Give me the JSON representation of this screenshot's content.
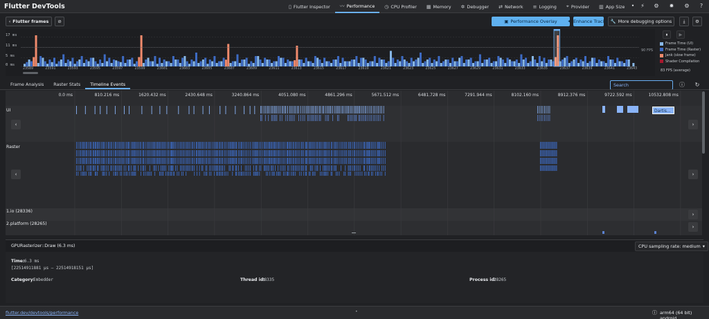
{
  "app": {
    "title": "Flutter DevTools"
  },
  "nav": {
    "tabs": [
      {
        "label": "Flutter Inspector",
        "icon": "phone-icon",
        "glyph": "▯"
      },
      {
        "label": "Performance",
        "icon": "pulse-icon",
        "glyph": "〰"
      },
      {
        "label": "CPU Profiler",
        "icon": "timer-icon",
        "glyph": "◷"
      },
      {
        "label": "Memory",
        "icon": "memory-icon",
        "glyph": "▦"
      },
      {
        "label": "Debugger",
        "icon": "bug-icon",
        "glyph": "✲"
      },
      {
        "label": "Network",
        "icon": "network-icon",
        "glyph": "⇄"
      },
      {
        "label": "Logging",
        "icon": "list-icon",
        "glyph": "≡"
      },
      {
        "label": "Provider",
        "icon": "provider-icon",
        "glyph": "⌖"
      },
      {
        "label": "App Size",
        "icon": "insert-chart-icon",
        "glyph": "▥"
      }
    ],
    "active_tab": "Performance"
  },
  "toolbar": {
    "flutter_frames": "Flutter frames",
    "performance_overlay": "Performance Overlay",
    "enhance_tracing": "Enhance Tracing",
    "more_debugging": "More debugging options"
  },
  "frames_chart": {
    "y_labels": [
      "17 ms",
      "11 ms",
      "5 ms",
      "0 ms"
    ],
    "x_labels": [
      "23589",
      "23591",
      "23593",
      "23595",
      "23597",
      "23599",
      "23601",
      "23603",
      "23605",
      "23607",
      "23609",
      "23611",
      "23613",
      "23615",
      "23617",
      "23619",
      "23621",
      "23623",
      "23625",
      "23627",
      "23629",
      "23631",
      "23633",
      "23635",
      "23637",
      "23639",
      "23641",
      "23643"
    ],
    "fps_label": "90 FPS",
    "average_fps": "83 FPS (average)",
    "legend": [
      {
        "label": "Frame Time (UI)",
        "color": "#88b8e8"
      },
      {
        "label": "Frame Time (Raster)",
        "color": "#3d6bc4"
      },
      {
        "label": "Jank (slow frame)",
        "color": "#f08a6c"
      },
      {
        "label": "Shader Compilation",
        "color": "#a8182e"
      }
    ]
  },
  "chart_data": {
    "type": "bar",
    "title": "",
    "ylabel": "",
    "xlabel": "",
    "ylim": [
      0,
      20
    ],
    "series": [
      {
        "name": "Frame Time (UI)",
        "values": [
          1.5,
          4,
          3,
          2,
          5,
          1.5,
          2.5,
          1.5,
          4,
          2,
          3,
          1.5,
          4,
          2,
          3,
          5,
          1.5,
          2,
          3,
          2,
          3.5,
          2.5,
          2,
          4,
          1.5,
          3,
          2,
          5,
          3,
          1.5,
          2,
          3,
          2,
          4,
          2,
          6,
          1.5,
          3,
          2,
          4,
          1.5,
          3,
          2,
          3,
          5,
          2,
          3,
          2,
          4,
          1.5,
          2,
          6,
          2,
          4,
          2,
          3,
          5,
          2,
          3,
          2,
          4,
          2,
          3,
          2,
          5,
          2,
          3,
          2,
          4,
          2,
          3,
          3,
          4,
          2,
          5,
          2,
          3,
          2,
          4,
          2,
          9,
          2,
          3,
          4,
          2,
          3,
          5,
          2,
          4,
          2,
          3,
          2,
          4,
          2,
          3,
          5,
          2,
          4,
          2,
          3,
          2,
          4,
          2,
          3,
          5,
          2,
          4,
          3,
          2,
          4,
          2,
          6,
          2,
          3,
          2,
          4,
          2,
          3,
          5,
          2,
          4,
          2,
          3,
          2,
          5,
          2,
          3,
          2,
          4,
          2,
          3,
          2,
          4,
          2
        ]
      },
      {
        "name": "Frame Time (Raster)",
        "values": [
          2.5,
          3,
          5,
          6,
          3,
          4,
          5,
          3,
          7,
          4,
          5,
          3,
          6,
          4,
          5,
          3,
          4,
          7,
          5,
          4,
          3,
          6,
          4,
          5,
          3,
          7,
          4,
          3,
          6,
          5,
          4,
          3,
          6,
          4,
          5,
          3,
          4,
          8,
          3,
          5,
          4,
          6,
          3,
          5,
          4,
          3,
          7,
          4,
          5,
          3,
          6,
          4,
          5,
          4,
          3,
          6,
          5,
          4,
          3,
          7,
          4,
          5,
          3,
          6,
          4,
          5,
          3,
          4,
          6,
          5,
          3,
          4,
          6,
          5,
          4,
          3,
          6,
          5,
          4,
          3,
          5,
          4,
          6,
          3,
          5,
          4,
          8,
          3,
          5,
          4,
          6,
          3,
          4,
          5,
          3,
          6,
          4,
          5,
          3,
          7,
          4,
          5,
          3,
          6,
          4,
          5,
          3,
          4,
          7,
          5,
          3,
          4,
          6,
          5,
          4,
          3,
          5,
          4,
          6,
          3,
          5,
          4,
          6,
          3,
          5,
          4,
          3,
          6,
          4,
          5,
          3,
          4
        ]
      },
      {
        "name": "Jank (slow frame)",
        "points": [
          {
            "frame": "23590",
            "value": 18
          },
          {
            "frame": "23599",
            "value": 18
          },
          {
            "frame": "23607",
            "value": 13
          },
          {
            "frame": "23613",
            "value": 12
          },
          {
            "frame": "23636",
            "value": 18
          }
        ]
      }
    ]
  },
  "timeline_tabs": [
    "Frame Analysis",
    "Raster Stats",
    "Timeline Events"
  ],
  "active_timeline_tab": "Timeline Events",
  "search_placeholder": "Search",
  "timeline": {
    "ticks": [
      "0.0 ms",
      "810.216 ms",
      "1620.432 ms",
      "2430.648 ms",
      "3240.864 ms",
      "4051.080 ms",
      "4861.296 ms",
      "5671.512 ms",
      "6481.728 ms",
      "7291.944 ms",
      "8102.160 ms",
      "8912.376 ms",
      "9722.592 ms",
      "10532.808 ms"
    ],
    "rows": {
      "ui": "UI",
      "raster": "Raster",
      "io": "1.io (28336)",
      "platform": "2.platform (28265)"
    },
    "selected_event_label": "Dartis..."
  },
  "details": {
    "title": "GPURasterizer::Draw (6.3 ms)",
    "cpu_sampling": "CPU sampling rate: medium",
    "time_label": "Time:",
    "time_value": "6.3 ms",
    "time_range": "[22514911881 μs –  22514918151 μs]",
    "category_label": "Category:",
    "category_value": "Embedder",
    "thread_label": "Thread id:",
    "thread_value": "28335",
    "process_label": "Process id:",
    "process_value": "28265"
  },
  "footer": {
    "link": "flutter.dev/devtools/performance",
    "dot": "•",
    "device": "arm64 (64 bit) android"
  }
}
